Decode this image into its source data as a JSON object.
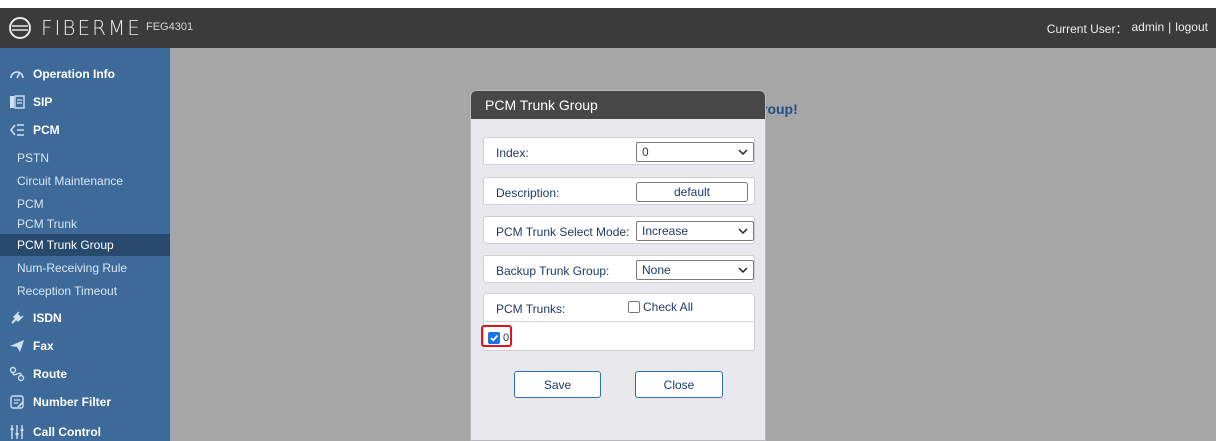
{
  "header": {
    "logo_text": "FIBERME",
    "model": "FEG4301",
    "current_user_label": "Current User：",
    "current_user": "admin",
    "separator": "|",
    "logout": "logout"
  },
  "sidebar": {
    "groups": [
      {
        "label": "Operation Info",
        "icon": "gauge-icon"
      },
      {
        "label": "SIP",
        "icon": "sip-icon"
      },
      {
        "label": "PCM",
        "icon": "pcm-icon"
      },
      {
        "label": "ISDN",
        "icon": "plug-icon"
      },
      {
        "label": "Fax",
        "icon": "paper-plane-icon"
      },
      {
        "label": "Route",
        "icon": "route-icon"
      },
      {
        "label": "Number Filter",
        "icon": "filter-icon"
      },
      {
        "label": "Call Control",
        "icon": "sliders-icon"
      }
    ],
    "pcm_items": [
      {
        "label": "PSTN"
      },
      {
        "label": "Circuit Maintenance"
      },
      {
        "label": "PCM"
      },
      {
        "label": "PCM Trunk"
      },
      {
        "label": "PCM Trunk Group",
        "active": true
      },
      {
        "label": "Num-Receiving Rule"
      },
      {
        "label": "Reception Timeout"
      }
    ]
  },
  "main": {
    "behind_text": "roup!"
  },
  "modal": {
    "title": "PCM Trunk Group",
    "index_label": "Index:",
    "index_value": "0",
    "description_label": "Description:",
    "description_value": "default",
    "select_mode_label": "PCM Trunk Select Mode:",
    "select_mode_value": "Increase",
    "backup_label": "Backup Trunk Group:",
    "backup_value": "None",
    "trunks_label": "PCM Trunks:",
    "check_all_label": "Check All",
    "trunks": [
      {
        "label": "0",
        "checked": true
      }
    ],
    "save_label": "Save",
    "close_label": "Close"
  },
  "colors": {
    "topbar": "#3b3b3b",
    "sidebar": "#3d6a99",
    "sidebar_active": "#26496d",
    "backdrop": "#a6a6a6",
    "highlight": "#e0141e"
  }
}
